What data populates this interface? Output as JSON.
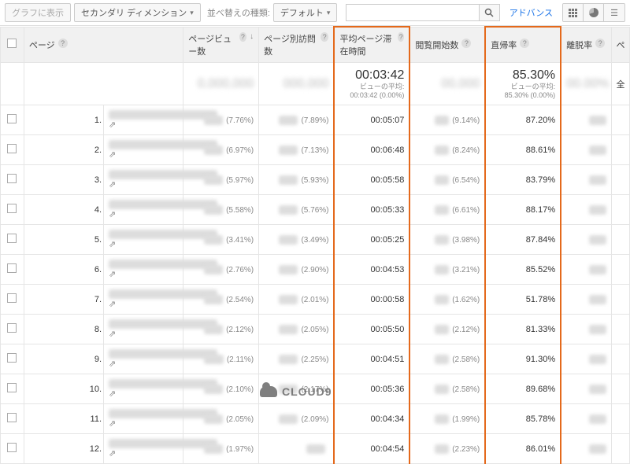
{
  "toolbar": {
    "show_graph": "グラフに表示",
    "secondary_dim": "セカンダリ ディメンション",
    "sort_label": "並べ替えの種類:",
    "sort_default": "デフォルト",
    "advanced": "アドバンス"
  },
  "headers": {
    "page": "ページ",
    "pageviews": "ページビュー数",
    "unique_pageviews": "ページ別訪問数",
    "avg_time": "平均ページ滞在時間",
    "entrances": "閲覧開始数",
    "bounce_rate": "直帰率",
    "exit_rate": "離脱率",
    "page_value_initial": "ペ",
    "page_value_continuation": "全"
  },
  "summary": {
    "avg_time": {
      "big": "00:03:42",
      "small": "ビューの平均:\n00:03:42 (0.00%)"
    },
    "bounce": {
      "big": "85.30%",
      "small": "ビューの平均:\n85.30% (0.00%)"
    }
  },
  "rows": [
    {
      "idx": "1.",
      "pv_pct": "(7.76%)",
      "up_pct": "(7.89%)",
      "time": "00:05:07",
      "ent_pct": "(9.14%)",
      "bounce": "87.20%"
    },
    {
      "idx": "2.",
      "pv_pct": "(6.97%)",
      "up_pct": "(7.13%)",
      "time": "00:06:48",
      "ent_pct": "(8.24%)",
      "bounce": "88.61%"
    },
    {
      "idx": "3.",
      "pv_pct": "(5.97%)",
      "up_pct": "(5.93%)",
      "time": "00:05:58",
      "ent_pct": "(6.54%)",
      "bounce": "83.79%"
    },
    {
      "idx": "4.",
      "pv_pct": "(5.58%)",
      "up_pct": "(5.76%)",
      "time": "00:05:33",
      "ent_pct": "(6.61%)",
      "bounce": "88.17%"
    },
    {
      "idx": "5.",
      "pv_pct": "(3.41%)",
      "up_pct": "(3.49%)",
      "time": "00:05:25",
      "ent_pct": "(3.98%)",
      "bounce": "87.84%"
    },
    {
      "idx": "6.",
      "pv_pct": "(2.76%)",
      "up_pct": "(2.90%)",
      "time": "00:04:53",
      "ent_pct": "(3.21%)",
      "bounce": "85.52%"
    },
    {
      "idx": "7.",
      "pv_pct": "(2.54%)",
      "up_pct": "(2.01%)",
      "time": "00:00:58",
      "ent_pct": "(1.62%)",
      "bounce": "51.78%"
    },
    {
      "idx": "8.",
      "pv_pct": "(2.12%)",
      "up_pct": "(2.05%)",
      "time": "00:05:50",
      "ent_pct": "(2.12%)",
      "bounce": "81.33%"
    },
    {
      "idx": "9.",
      "pv_pct": "(2.11%)",
      "up_pct": "(2.25%)",
      "time": "00:04:51",
      "ent_pct": "(2.58%)",
      "bounce": "91.30%"
    },
    {
      "idx": "10.",
      "pv_pct": "(2.10%)",
      "up_pct": "(2.17%)",
      "time": "00:05:36",
      "ent_pct": "(2.58%)",
      "bounce": "89.68%"
    },
    {
      "idx": "11.",
      "pv_pct": "(2.05%)",
      "up_pct": "(2.09%)",
      "time": "00:04:34",
      "ent_pct": "(1.99%)",
      "bounce": "85.78%"
    },
    {
      "idx": "12.",
      "pv_pct": "(1.97%)",
      "up_pct": "",
      "time": "00:04:54",
      "ent_pct": "(2.23%)",
      "bounce": "86.01%"
    }
  ],
  "watermark": "CLOUD9"
}
